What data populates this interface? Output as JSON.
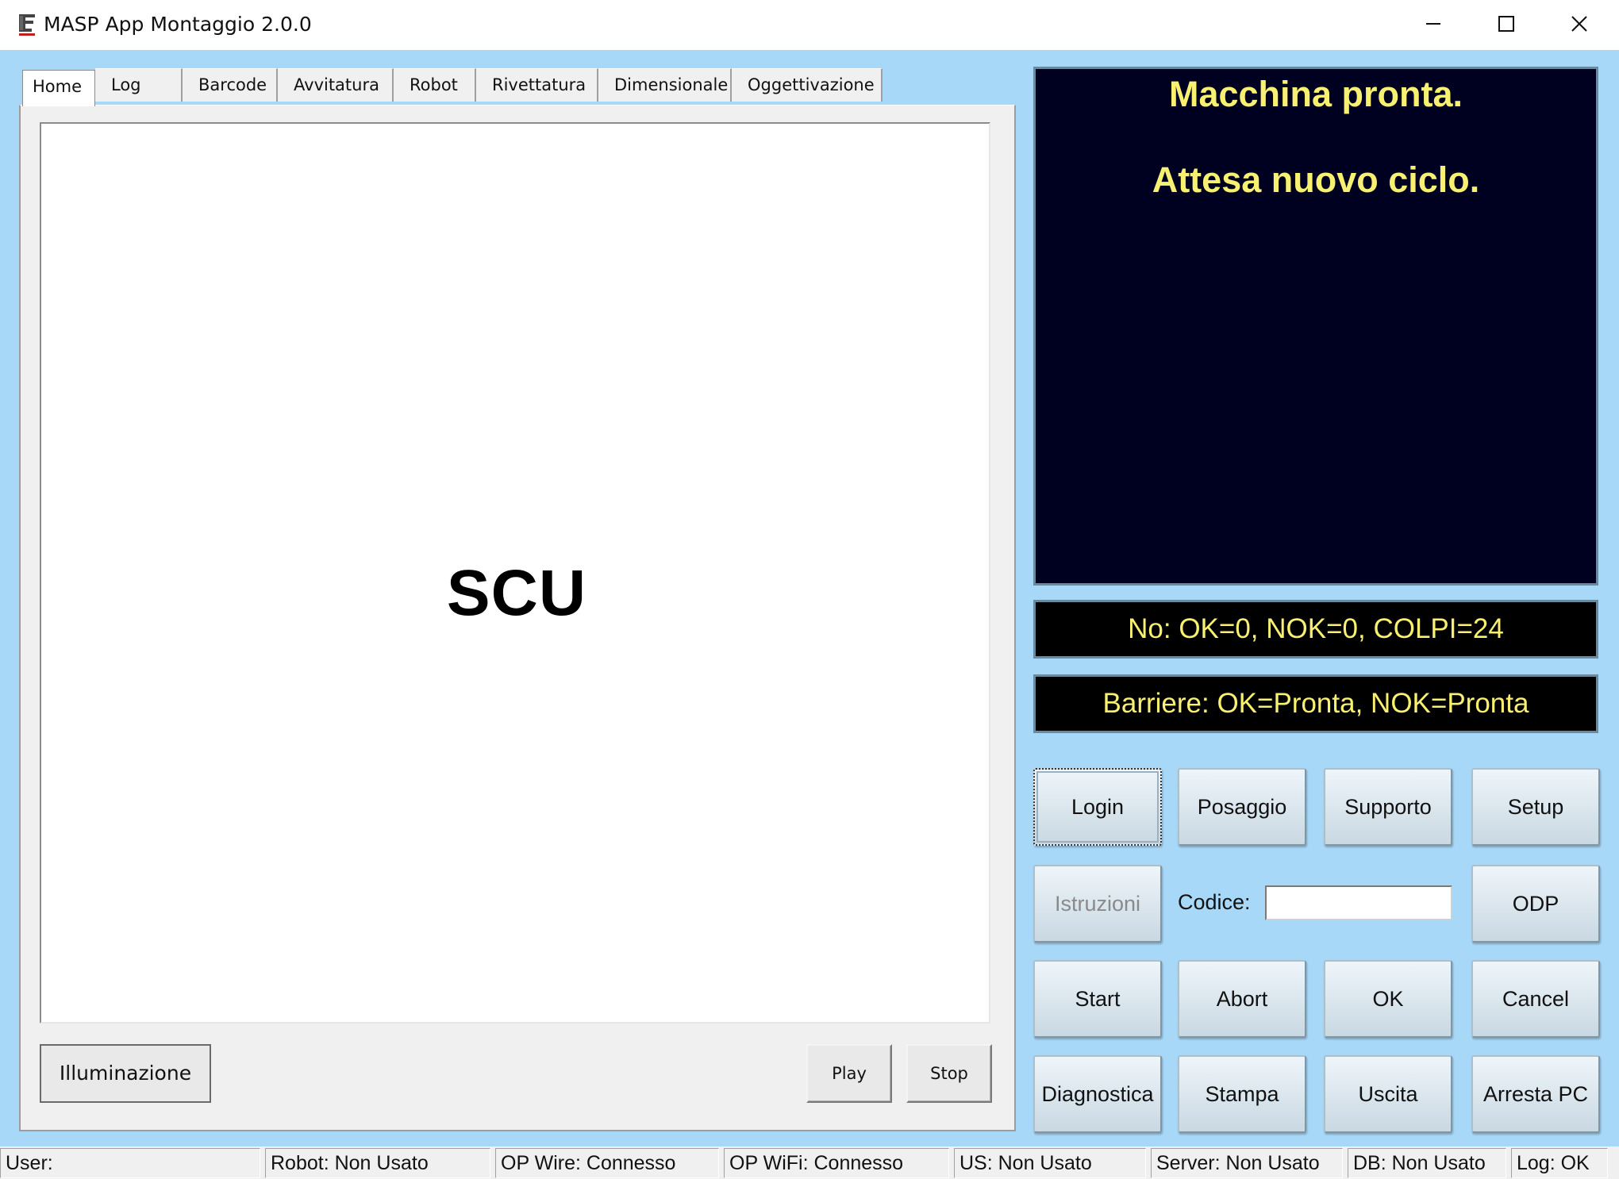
{
  "window": {
    "title": "MASP App Montaggio 2.0.0"
  },
  "tabs": [
    {
      "label": "Home",
      "active": true
    },
    {
      "label": "Log",
      "active": false
    },
    {
      "label": "Barcode",
      "active": false
    },
    {
      "label": "Avvitatura",
      "active": false
    },
    {
      "label": "Robot",
      "active": false
    },
    {
      "label": "Rivettatura",
      "active": false
    },
    {
      "label": "Dimensionale",
      "active": false
    },
    {
      "label": "Oggettivazione",
      "active": false
    }
  ],
  "home": {
    "product_label": "SCU",
    "illuminazione_label": "Illuminazione",
    "play_label": "Play",
    "stop_label": "Stop"
  },
  "message": {
    "line1": "Macchina pronta.",
    "line2": "Attesa nuovo ciclo."
  },
  "counters": {
    "text": "No: OK=0, NOK=0, COLPI=24"
  },
  "barriers": {
    "text": "Barriere: OK=Pronta, NOK=Pronta"
  },
  "buttons": {
    "login": "Login",
    "posaggio": "Posaggio",
    "supporto": "Supporto",
    "setup": "Setup",
    "istruzioni": "Istruzioni",
    "codice_label": "Codice:",
    "codice_value": "",
    "odp": "ODP",
    "start": "Start",
    "abort": "Abort",
    "ok": "OK",
    "cancel": "Cancel",
    "diagnostica": "Diagnostica",
    "stampa": "Stampa",
    "uscita": "Uscita",
    "arresta": "Arresta PC"
  },
  "status": {
    "user": "User:",
    "robot": "Robot: Non Usato",
    "op_wire": "OP Wire: Connesso",
    "op_wifi": "OP WiFi: Connesso",
    "us": "US: Non Usato",
    "server": "Server: Non Usato",
    "db": "DB: Non Usato",
    "log": "Log: OK"
  },
  "colors": {
    "client_background": "#a8d8f8",
    "message_background": "#000020",
    "message_text": "#f8f070"
  },
  "icons": {
    "app": "app-logo-icon",
    "minimize": "minimize-icon",
    "maximize": "maximize-icon",
    "close": "close-icon"
  }
}
